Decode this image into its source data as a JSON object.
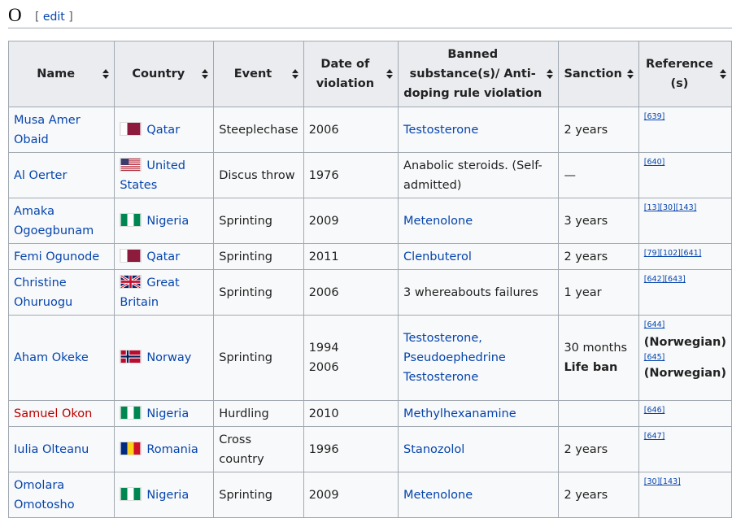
{
  "section": {
    "letter": "O",
    "edit_open": "[",
    "edit_label": "edit",
    "edit_close": "]"
  },
  "columns": [
    "Name",
    "Country",
    "Event",
    "Date of violation",
    "Banned substance(s)/ Anti-doping rule violation",
    "Sanction",
    "Reference (s)"
  ],
  "rows": [
    {
      "name": "Musa Amer Obaid",
      "country": "Qatar",
      "event": "Steeplechase",
      "date": "2006",
      "substance": "Testosterone",
      "sanction": "2 years",
      "refs": "[639]"
    },
    {
      "name": "Al Oerter",
      "country": "United States",
      "event": "Discus throw",
      "date": "1976",
      "substance": "Anabolic steroids. (Self-admitted)",
      "sanction": "—",
      "refs": "[640]"
    },
    {
      "name": "Amaka Ogoegbunam",
      "country": "Nigeria",
      "event": "Sprinting",
      "date": "2009",
      "substance": "Metenolone",
      "sanction": "3 years",
      "refs": "[13][30][143]"
    },
    {
      "name": "Femi Ogunode",
      "country": "Qatar",
      "event": "Sprinting",
      "date": "2011",
      "substance": "Clenbuterol",
      "sanction": "2 years",
      "refs": "[79][102][641]"
    },
    {
      "name": "Christine Ohuruogu",
      "country": "Great Britain",
      "event": "Sprinting",
      "date": "2006",
      "substance": "3 whereabouts failures",
      "sanction": "1 year",
      "refs": "[642][643]"
    },
    {
      "name": "Aham Okeke",
      "country": "Norway",
      "event": "Sprinting",
      "date1": "1994",
      "date2": "2006",
      "substance1": "Testosterone,",
      "substance2": "Pseudoephedrine",
      "substance3": "Testosterone",
      "sanction1": "30 months",
      "sanction2": "Life ban",
      "ref1": "[644]",
      "note1": "(Norwegian)",
      "ref2": "[645]",
      "note2": "(Norwegian)"
    },
    {
      "name": "Samuel Okon",
      "country": "Nigeria",
      "event": "Hurdling",
      "date": "2010",
      "substance": "Methylhexanamine",
      "sanction": "",
      "refs": "[646]"
    },
    {
      "name": "Iulia Olteanu",
      "country": "Romania",
      "event": "Cross country",
      "date": "1996",
      "substance": "Stanozolol",
      "sanction": "2 years",
      "refs": "[647]"
    },
    {
      "name": "Omolara Omotosho",
      "country": "Nigeria",
      "event": "Sprinting",
      "date": "2009",
      "substance": "Metenolone",
      "sanction": "2 years",
      "refs": "[30][143]"
    }
  ]
}
